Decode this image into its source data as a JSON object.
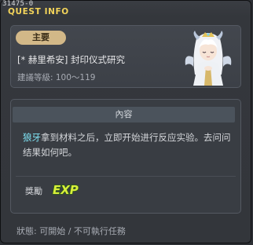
{
  "quest_id": "31475-0",
  "window_title": "QUEST INFO",
  "header": {
    "tag": "主要",
    "quest_name": "[* 赫里希安] 封印仪式研究",
    "required_level": "建議等級: 100～119"
  },
  "content": {
    "section_title": "內容",
    "description_highlight": "狼牙",
    "description_rest": "拿到材料之后，立即开始进行反应实验。去问问结果如何吧。",
    "reward_label": "獎勵",
    "reward_icon_text": "EXP"
  },
  "status": "狀態: 可開始 / 不可執行任務",
  "colors": {
    "title": "#f3d45a",
    "highlight": "#7fe3f4",
    "tag_bg": "#d2b888",
    "exp_icon": "#d8ef3a"
  },
  "icons": [
    "npc-portrait",
    "exp-icon"
  ]
}
